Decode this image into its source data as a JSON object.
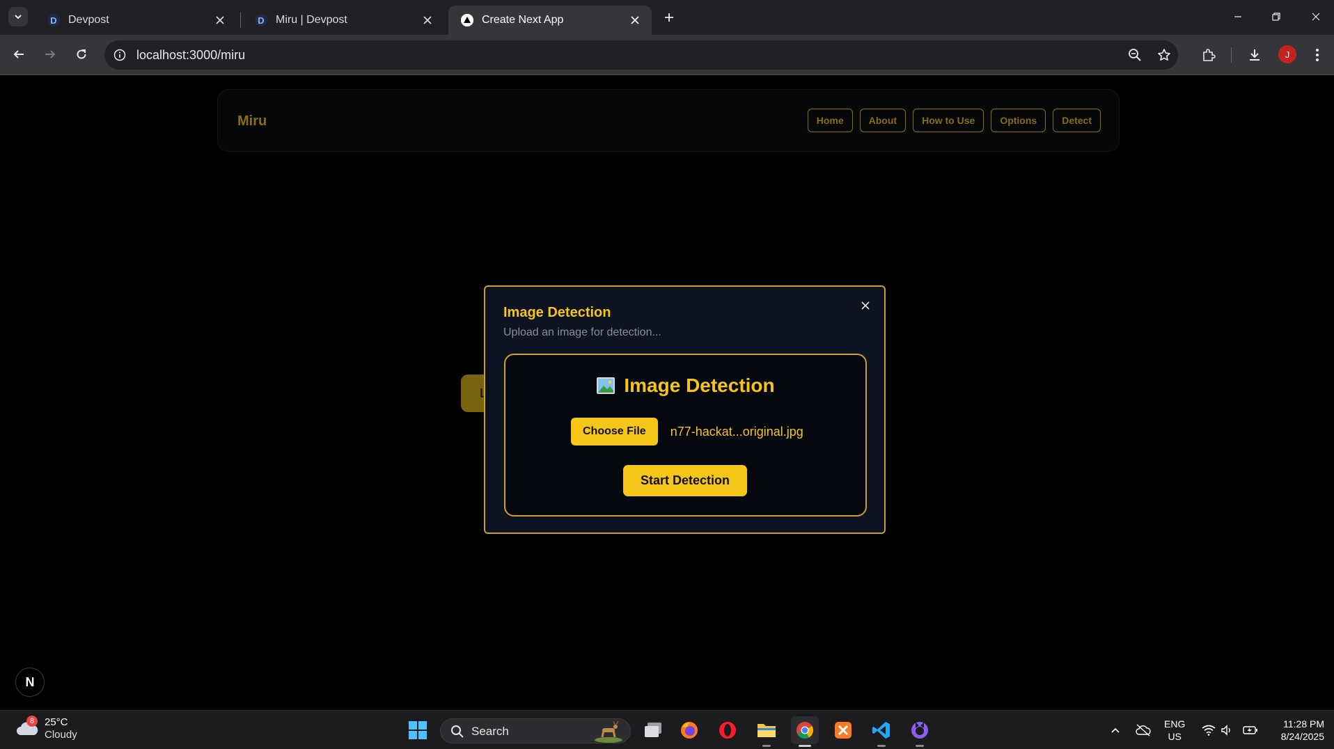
{
  "browser": {
    "tabs": [
      {
        "title": "Devpost",
        "favicon": "D",
        "active": false
      },
      {
        "title": "Miru | Devpost",
        "favicon": "D",
        "active": false
      },
      {
        "title": "Create Next App",
        "favicon": "next-triangle",
        "active": true
      }
    ],
    "url": "localhost:3000/miru",
    "profile_initial": "J"
  },
  "page": {
    "brand": "Miru",
    "nav": [
      "Home",
      "About",
      "How to Use",
      "Options",
      "Detect"
    ],
    "behind_button_initial": "L",
    "next_badge": "N"
  },
  "modal": {
    "title": "Image Detection",
    "subtitle": "Upload an image for detection...",
    "panel_heading": "Image Detection",
    "choose_file_label": "Choose File",
    "file_name": "n77-hackat...original.jpg",
    "start_label": "Start Detection"
  },
  "taskbar": {
    "weather_temp": "25°C",
    "weather_cond": "Cloudy",
    "weather_badge": "8",
    "search_label": "Search",
    "lang_line1": "ENG",
    "lang_line2": "US",
    "time": "11:28 PM",
    "date": "8/24/2025"
  },
  "colors": {
    "accent": "#f5c518",
    "accent_dim": "#8a6f12",
    "modal_bg": "#0d1320"
  }
}
